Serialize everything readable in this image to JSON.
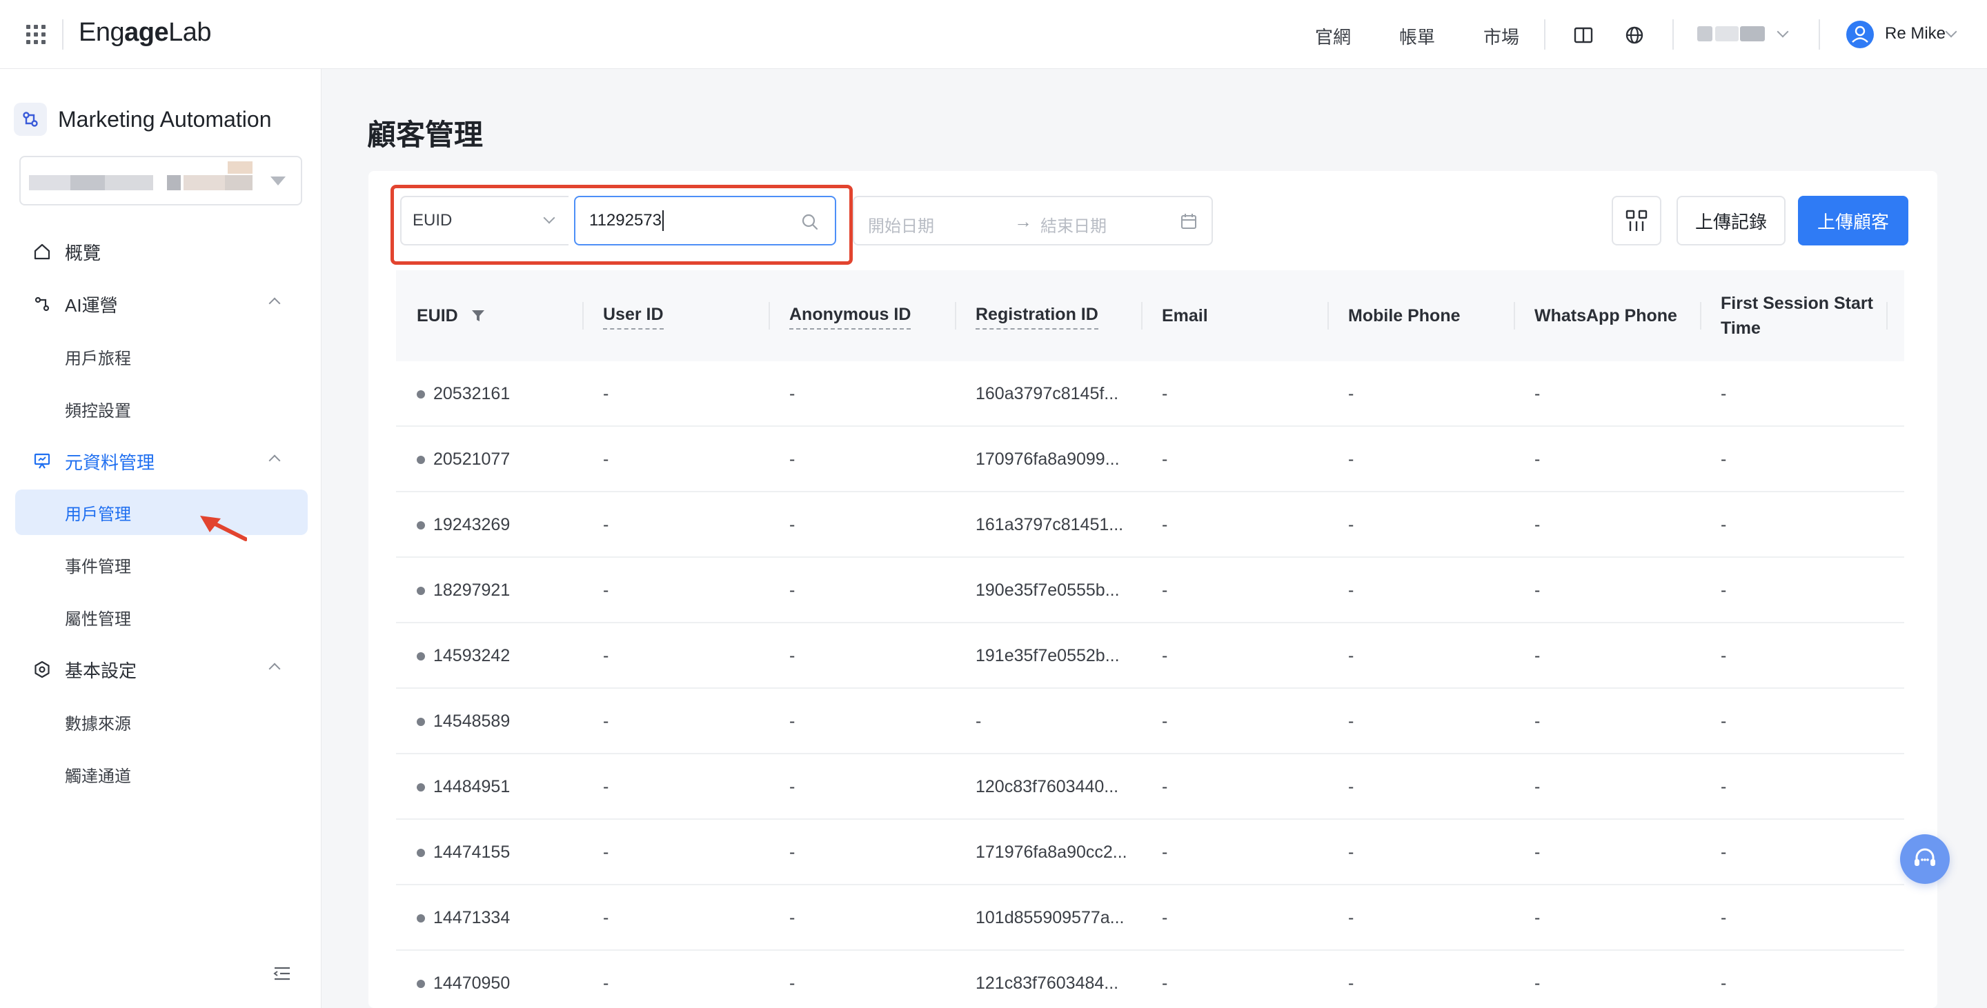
{
  "topbar": {
    "logo_prefix": "Eng",
    "logo_middle": "age",
    "logo_suffix": "Lab",
    "nav": [
      "官網",
      "帳單",
      "市場"
    ],
    "user_name": "Re Mike"
  },
  "sidebar": {
    "app_title": "Marketing Automation",
    "items": {
      "overview": "概覽",
      "ai_ops": "AI運營",
      "user_journey": "用戶旅程",
      "freq_control": "頻控設置",
      "metadata": "元資料管理",
      "user_mgmt": "用戶管理",
      "event_mgmt": "事件管理",
      "attr_mgmt": "屬性管理",
      "basic_settings": "基本設定",
      "data_source": "數據來源",
      "reach_channel": "觸達通道"
    }
  },
  "main": {
    "page_title": "顧客管理",
    "filter": {
      "field": "EUID",
      "search_value": "11292573",
      "start_date_placeholder": "開始日期",
      "end_date_placeholder": "結束日期",
      "arrow": "→"
    },
    "buttons": {
      "upload_records": "上傳記錄",
      "upload_customers": "上傳顧客"
    },
    "columns": [
      "EUID",
      "User ID",
      "Anonymous ID",
      "Registration ID",
      "Email",
      "Mobile Phone",
      "WhatsApp Phone",
      "First Session Start Time"
    ],
    "rows": [
      {
        "euid": "20532161",
        "user_id": "-",
        "anon_id": "-",
        "reg_id": "160a3797c8145f...",
        "email": "-",
        "mobile": "-",
        "whatsapp": "-",
        "first_session": "-"
      },
      {
        "euid": "20521077",
        "user_id": "-",
        "anon_id": "-",
        "reg_id": "170976fa8a9099...",
        "email": "-",
        "mobile": "-",
        "whatsapp": "-",
        "first_session": "-"
      },
      {
        "euid": "19243269",
        "user_id": "-",
        "anon_id": "-",
        "reg_id": "161a3797c81451...",
        "email": "-",
        "mobile": "-",
        "whatsapp": "-",
        "first_session": "-"
      },
      {
        "euid": "18297921",
        "user_id": "-",
        "anon_id": "-",
        "reg_id": "190e35f7e0555b...",
        "email": "-",
        "mobile": "-",
        "whatsapp": "-",
        "first_session": "-"
      },
      {
        "euid": "14593242",
        "user_id": "-",
        "anon_id": "-",
        "reg_id": "191e35f7e0552b...",
        "email": "-",
        "mobile": "-",
        "whatsapp": "-",
        "first_session": "-"
      },
      {
        "euid": "14548589",
        "user_id": "-",
        "anon_id": "-",
        "reg_id": "-",
        "email": "-",
        "mobile": "-",
        "whatsapp": "-",
        "first_session": "-"
      },
      {
        "euid": "14484951",
        "user_id": "-",
        "anon_id": "-",
        "reg_id": "120c83f7603440...",
        "email": "-",
        "mobile": "-",
        "whatsapp": "-",
        "first_session": "-"
      },
      {
        "euid": "14474155",
        "user_id": "-",
        "anon_id": "-",
        "reg_id": "171976fa8a90cc2...",
        "email": "-",
        "mobile": "-",
        "whatsapp": "-",
        "first_session": "-"
      },
      {
        "euid": "14471334",
        "user_id": "-",
        "anon_id": "-",
        "reg_id": "101d855909577a...",
        "email": "-",
        "mobile": "-",
        "whatsapp": "-",
        "first_session": "-"
      },
      {
        "euid": "14470950",
        "user_id": "-",
        "anon_id": "-",
        "reg_id": "121c83f7603484...",
        "email": "-",
        "mobile": "-",
        "whatsapp": "-",
        "first_session": "-"
      }
    ]
  },
  "colors": {
    "accent": "#2f7bf5",
    "active_bg": "#e3edfd",
    "highlight_border": "#e2442f"
  }
}
